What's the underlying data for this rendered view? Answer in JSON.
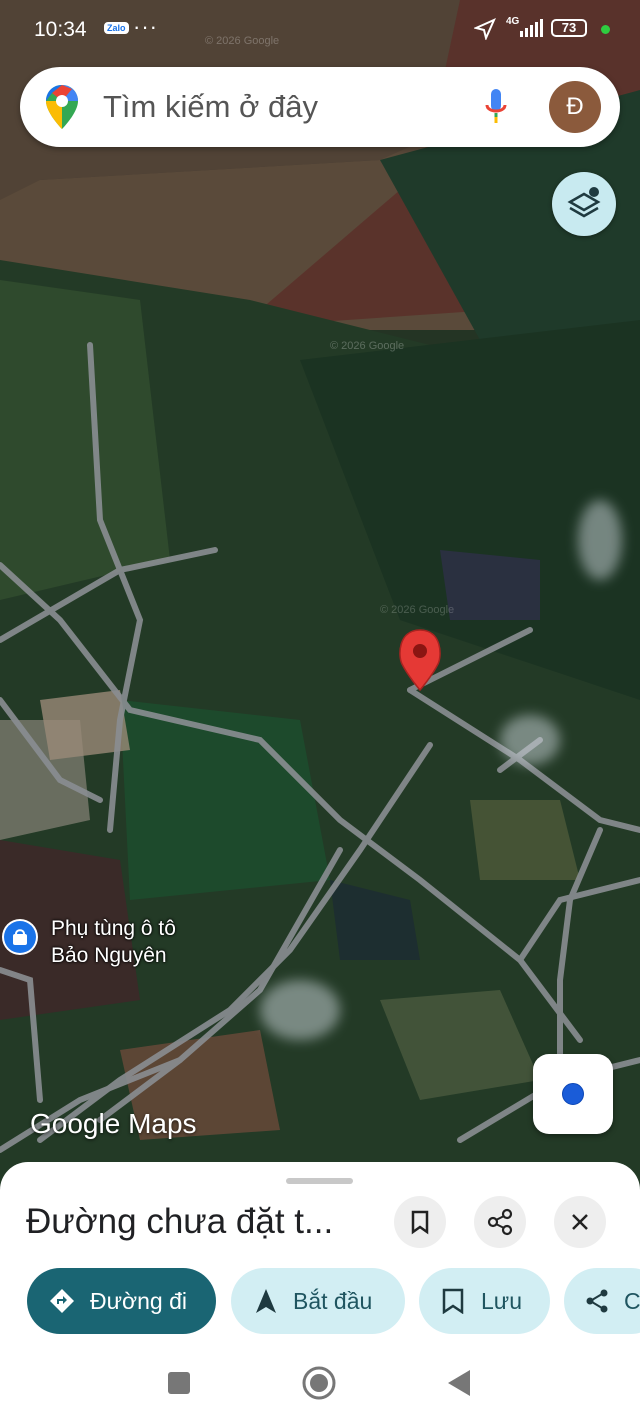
{
  "status_bar": {
    "time": "10:34",
    "app_badge": "Zalo",
    "more": "···",
    "network": "4G",
    "battery": "73"
  },
  "search": {
    "placeholder": "Tìm kiếm ở đây",
    "avatar_initial": "Đ"
  },
  "map": {
    "poi": {
      "line1": "Phụ tùng ô tô",
      "line2": "Bảo Nguyên"
    },
    "brand": "Google Maps",
    "watermark": "© 2026 Google"
  },
  "sheet": {
    "title": "Đường chưa đặt t...",
    "chips": {
      "directions": "Đường đi",
      "start": "Bắt đầu",
      "save": "Lưu",
      "share": "C"
    }
  },
  "colors": {
    "accent_dark": "#1a6573",
    "chip_bg": "#d2eef3",
    "pin_red": "#e53935",
    "location_blue": "#1a5cd8"
  }
}
